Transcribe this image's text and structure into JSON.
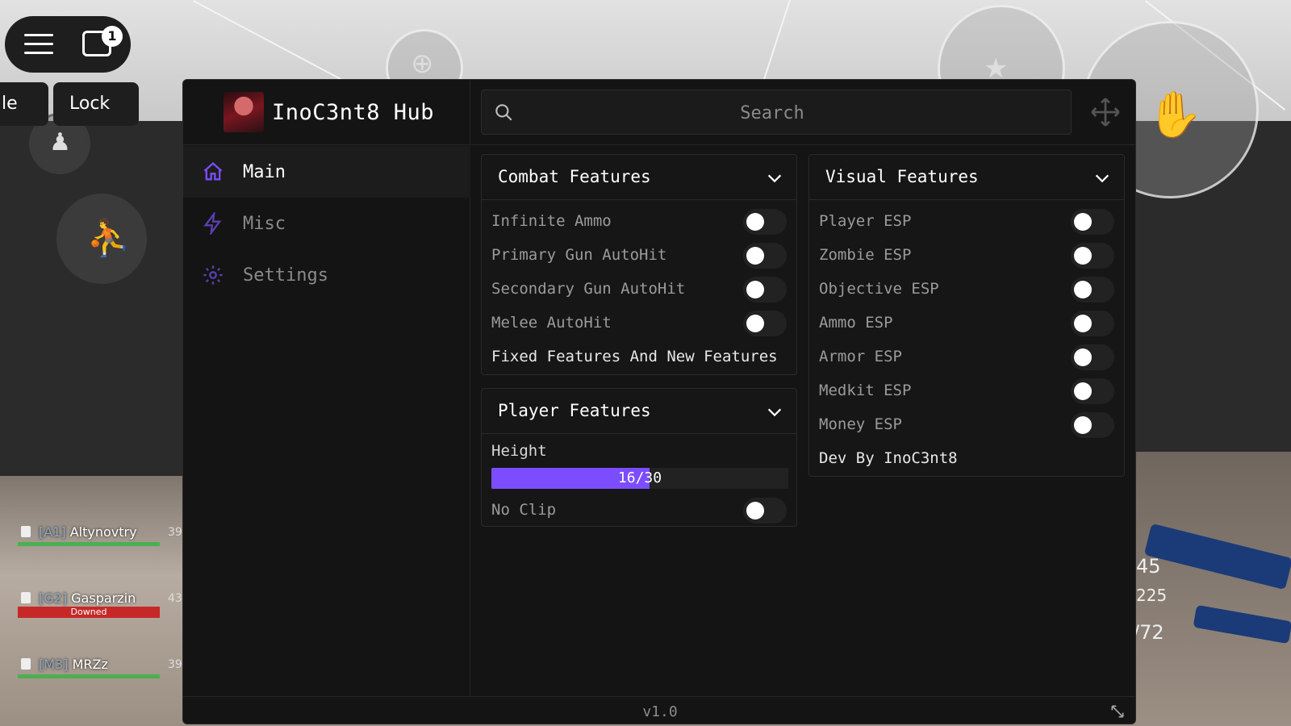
{
  "hud": {
    "chat_badge": "1",
    "left_pill_label": "le",
    "lock_label": "Lock"
  },
  "scoreboard": [
    {
      "tag": "[A1]",
      "name": "Altynovtry",
      "score": "39",
      "status": ""
    },
    {
      "tag": "[G2]",
      "name": "Gasparzin",
      "score": "43",
      "status": "Downed"
    },
    {
      "tag": "[M3]",
      "name": "MRZz",
      "score": "39",
      "status": ""
    }
  ],
  "ammo": [
    "45",
    "225",
    "/72"
  ],
  "hub": {
    "title": "InoC3nt8 Hub",
    "nav": [
      {
        "label": "Main",
        "icon": "home-icon",
        "active": true
      },
      {
        "label": "Misc",
        "icon": "lightning-icon",
        "active": false
      },
      {
        "label": "Settings",
        "icon": "gear-icon",
        "active": false
      }
    ],
    "search": {
      "placeholder": "Search",
      "value": ""
    },
    "sections": {
      "combat": {
        "title": "Combat Features",
        "toggles": [
          {
            "label": "Infinite Ammo",
            "on": false
          },
          {
            "label": "Primary Gun AutoHit",
            "on": false
          },
          {
            "label": "Secondary Gun AutoHit",
            "on": false
          },
          {
            "label": "Melee AutoHit",
            "on": false
          }
        ],
        "note": "Fixed Features And New Features"
      },
      "player": {
        "title": "Player Features",
        "slider": {
          "label": "Height",
          "value": 16,
          "max": 30,
          "text": "16/30"
        },
        "toggles": [
          {
            "label": "No Clip",
            "on": false
          }
        ]
      },
      "visual": {
        "title": "Visual Features",
        "toggles": [
          {
            "label": "Player ESP",
            "on": false
          },
          {
            "label": "Zombie ESP",
            "on": false
          },
          {
            "label": "Objective ESP",
            "on": false
          },
          {
            "label": "Ammo ESP",
            "on": false
          },
          {
            "label": "Armor ESP",
            "on": false
          },
          {
            "label": "Medkit ESP",
            "on": false
          },
          {
            "label": "Money ESP",
            "on": false
          }
        ],
        "note": "Dev By InoC3nt8"
      }
    },
    "version": "v1.0"
  },
  "colors": {
    "accent": "#7c4dff",
    "window_bg": "#141414",
    "panel_bg": "#161616",
    "toggle_off": "#222222",
    "knob": "#ffffff"
  }
}
